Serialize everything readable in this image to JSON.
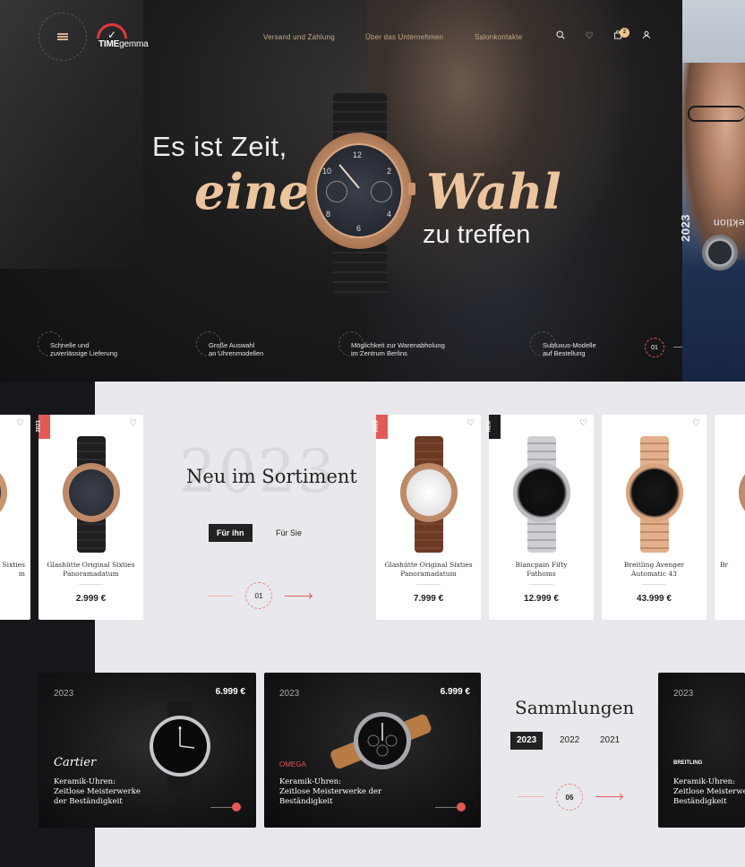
{
  "colors": {
    "accent_gold": "#ecc49d",
    "accent_red": "#e25a56",
    "dark_bg": "#16171a",
    "light_bg": "#e9e8ec"
  },
  "header": {
    "logo_text_a": "TIME",
    "logo_text_b": "gemma",
    "nav": [
      "Versand und Zahlung",
      "Über das Unternehmen",
      "Salonkontakte"
    ],
    "cart_count": "2",
    "icons": [
      "menu-icon",
      "search-icon",
      "heart-icon",
      "cart-icon",
      "user-icon"
    ]
  },
  "hero": {
    "line1": "Es ist Zeit,",
    "line2a": "eine",
    "line2b": "Wahl",
    "line3": "zu treffen",
    "side_label": "Neue Kollektion",
    "side_year": "2023",
    "watch_numerals": [
      "12",
      "2",
      "4",
      "6",
      "8",
      "10"
    ],
    "pager": "01",
    "features": [
      {
        "line1": "Schnelle und",
        "line2": "zuverlässige Lieferung"
      },
      {
        "line1": "Große Auswahl",
        "line2": "an Uhrenmodellen"
      },
      {
        "line1": "Möglichkeit zur Warenabholung",
        "line2": "im Zentrum Berlins"
      },
      {
        "line1": "Subluxus-Modelle",
        "line2": "auf Bestellung"
      }
    ]
  },
  "sortiment": {
    "bg_year": "2023",
    "title": "Neu im Sortiment",
    "tabs": [
      "Für ihn",
      "Für Sie"
    ],
    "pager": "01",
    "products": [
      {
        "badge": "",
        "name_l1": "Sixties",
        "name_l2": "m",
        "price": ""
      },
      {
        "badge": "2023",
        "name_l1": "Glashütte Original Sixties",
        "name_l2": "Panoramadatum",
        "price": "2.999 €"
      },
      {
        "badge": "2023",
        "name_l1": "Glashütte Original Sixties",
        "name_l2": "Panoramadatum",
        "price": "7.999 €"
      },
      {
        "badge": "NEU",
        "name_l1": "Blancpain Fifty",
        "name_l2": "Fathoms",
        "price": "12.999 €"
      },
      {
        "badge": "",
        "name_l1": "Breitling Avenger",
        "name_l2": "Automatic 43",
        "price": "43.999 €"
      },
      {
        "badge": "",
        "name_l1": "Br",
        "name_l2": "",
        "price": ""
      }
    ]
  },
  "collections": {
    "title": "Sammlungen",
    "years": [
      "2023",
      "2022",
      "2021"
    ],
    "pager": "06",
    "cards": [
      {
        "year": "2023",
        "price": "6.999 €",
        "brand": "Cartier",
        "desc_l1": "Keramik-Uhren:",
        "desc_l2": "Zeitlose Meisterwerke",
        "desc_l3": "der Beständigkeit"
      },
      {
        "year": "2023",
        "price": "6.999 €",
        "brand": "OMEGA",
        "desc_l1": "Keramik-Uhren:",
        "desc_l2": "Zeitlose Meisterwerke der",
        "desc_l3": "Beständigkeit"
      },
      {
        "year": "2023",
        "price": "",
        "brand": "BREITLING",
        "desc_l1": "Keramik-Uhren:",
        "desc_l2": "Zeitlose Meisterwerke",
        "desc_l3": "Beständigkeit"
      }
    ]
  }
}
